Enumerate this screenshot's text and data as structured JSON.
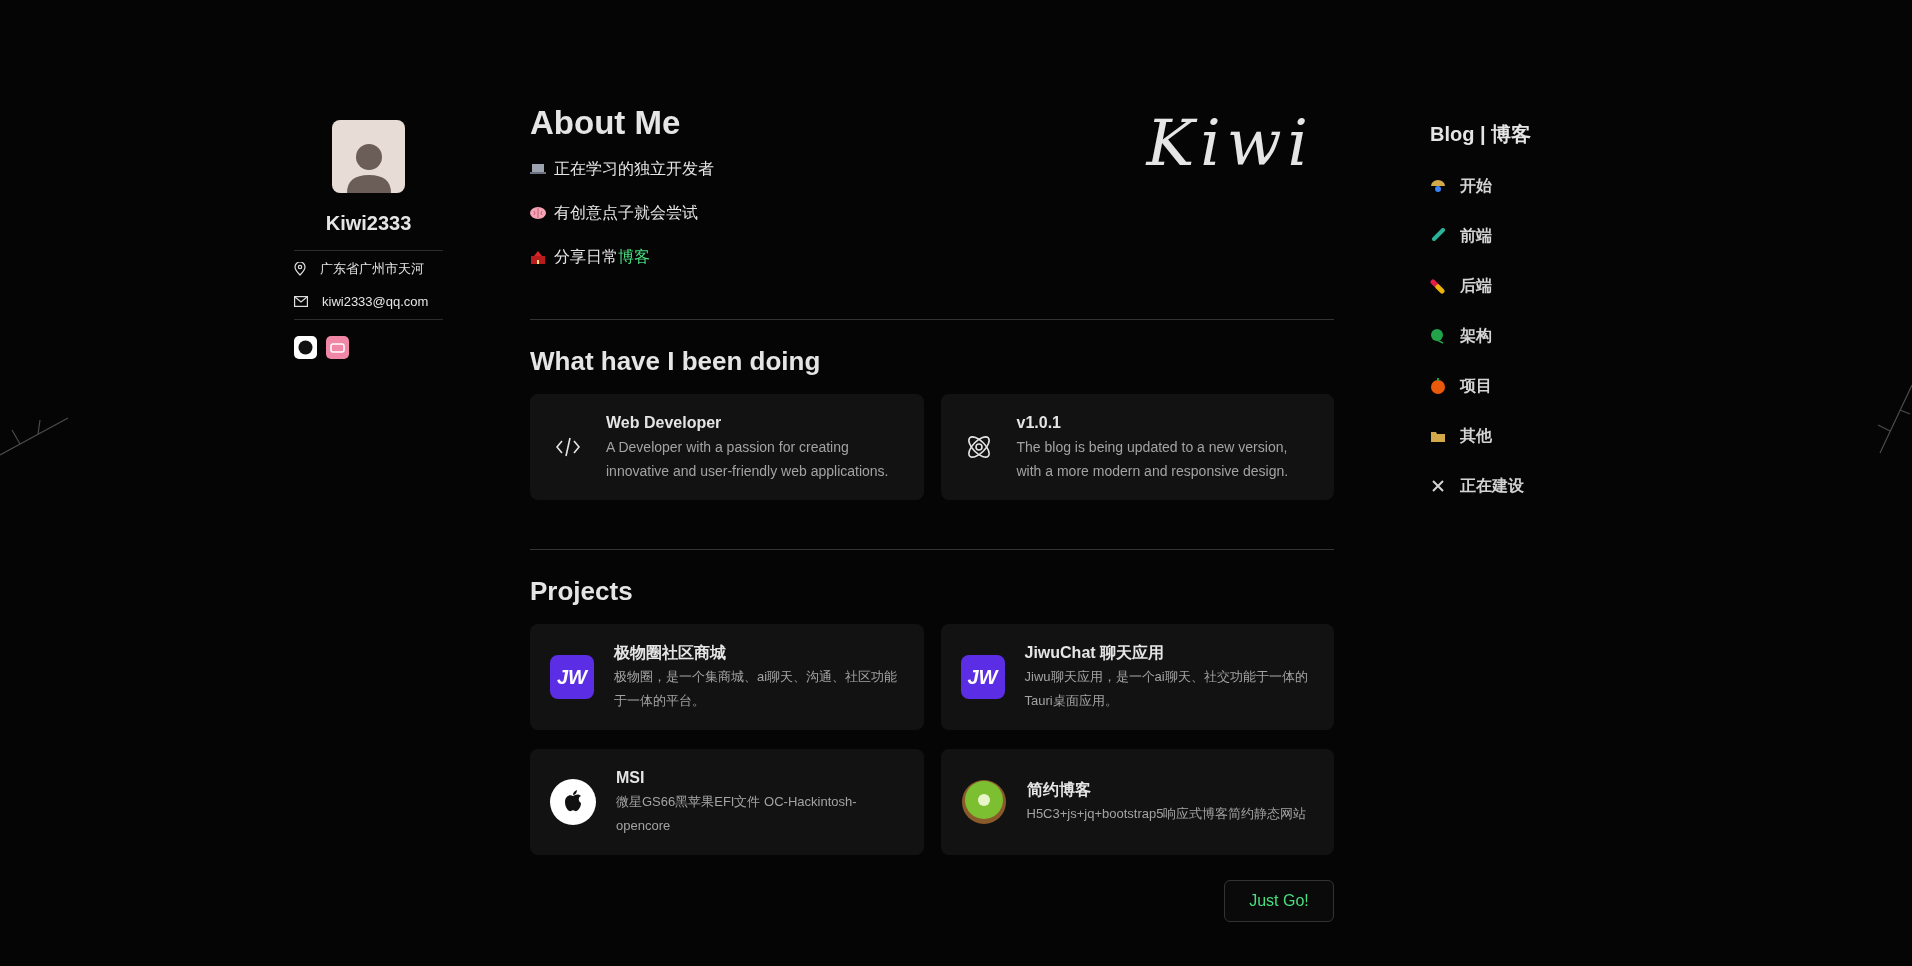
{
  "profile": {
    "name": "Kiwi2333",
    "location": "广东省广州市天河",
    "email": "kiwi2333@qq.com"
  },
  "about": {
    "title": "About Me",
    "signature": "Kiwi",
    "lines": [
      {
        "text": "正在学习的独立开发者"
      },
      {
        "text": "有创意点子就会尝试"
      },
      {
        "text": "分享日常",
        "link": "博客"
      }
    ]
  },
  "doing": {
    "title": "What have I been doing",
    "cards": [
      {
        "title": "Web Developer",
        "description": "A Developer with a passion for creating innovative and user-friendly web applications."
      },
      {
        "title": "v1.0.1",
        "description": "The blog is being updated to a new version, with a more modern and responsive design."
      }
    ]
  },
  "projects": {
    "title": "Projects",
    "cards": [
      {
        "logo_text": "JW",
        "title": "极物圈社区商城",
        "description": "极物圈，是一个集商城、ai聊天、沟通、社区功能于一体的平台。"
      },
      {
        "logo_text": "JW",
        "title": "JiwuChat 聊天应用",
        "description": "Jiwu聊天应用，是一个ai聊天、社交功能于一体的Tauri桌面应用。"
      },
      {
        "title": "MSI",
        "description": "微星GS66黑苹果EFI文件 OC-Hackintosh-opencore"
      },
      {
        "title": "简约博客",
        "description": "H5C3+js+jq+bootstrap5响应式博客简约静态网站"
      }
    ],
    "button": "Just Go!"
  },
  "blog": {
    "title": "Blog | 博客",
    "items": [
      {
        "label": "开始"
      },
      {
        "label": "前端"
      },
      {
        "label": "后端"
      },
      {
        "label": "架构"
      },
      {
        "label": "项目"
      },
      {
        "label": "其他"
      },
      {
        "label": "正在建设"
      }
    ]
  }
}
